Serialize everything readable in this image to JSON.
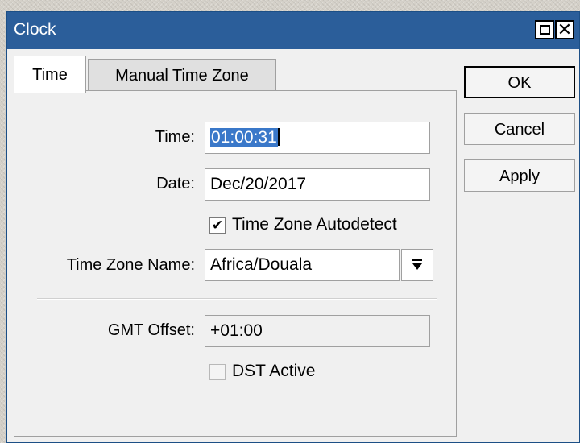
{
  "window": {
    "title": "Clock",
    "close_glyph": "✕"
  },
  "tabs": [
    {
      "label": "Time",
      "active": true
    },
    {
      "label": "Manual Time Zone",
      "active": false
    }
  ],
  "form": {
    "time": {
      "label": "Time:",
      "value": "01:00:31"
    },
    "date": {
      "label": "Date:",
      "value": "Dec/20/2017"
    },
    "autodetect": {
      "label": "Time Zone Autodetect",
      "checked": true,
      "mark": "✔"
    },
    "tz_name": {
      "label": "Time Zone Name:",
      "value": "Africa/Douala"
    },
    "gmt_offset": {
      "label": "GMT Offset:",
      "value": "+01:00"
    },
    "dst_active": {
      "label": "DST Active",
      "checked": false
    }
  },
  "buttons": {
    "ok": "OK",
    "cancel": "Cancel",
    "apply": "Apply"
  },
  "colors": {
    "titlebar": "#2b5e9a",
    "selection": "#3a78c9",
    "window_bg": "#f0f0f0"
  }
}
